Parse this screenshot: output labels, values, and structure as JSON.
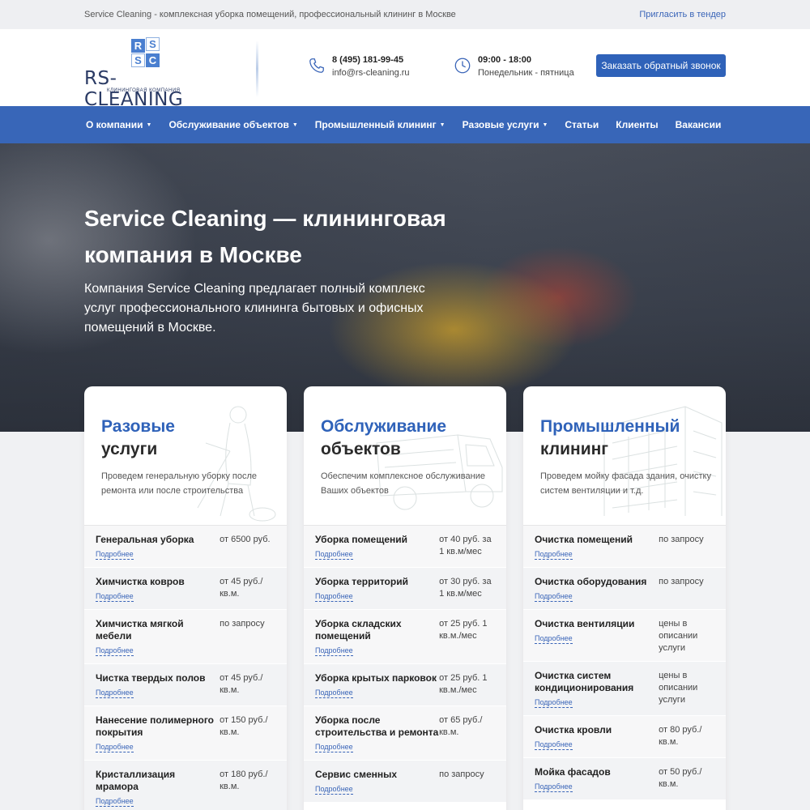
{
  "topbar": {
    "tagline": "Service Cleaning - комплексная уборка помещений, профессиональный клининг в Москве",
    "tender_link": "Пригласить в тендер"
  },
  "logo": {
    "letters": [
      "R",
      "S",
      "S",
      "C"
    ],
    "wordmark": "RS-CLEANING",
    "subtitle": "КЛИНИНГОВАЯ КОМПАНИЯ"
  },
  "contacts": {
    "phone": "8 (495) 181-99-45",
    "email": "info@rs-cleaning.ru",
    "hours": "09:00 - 18:00",
    "days": "Понедельник - пятница",
    "phone_icon": "phone-icon",
    "clock_icon": "clock-icon"
  },
  "callback_button": "Заказать обратный звонок",
  "nav": [
    {
      "label": "О компании",
      "dropdown": true
    },
    {
      "label": "Обслуживание объектов",
      "dropdown": true
    },
    {
      "label": "Промышленный клининг",
      "dropdown": true
    },
    {
      "label": "Разовые услуги",
      "dropdown": true
    },
    {
      "label": "Статьи",
      "dropdown": false
    },
    {
      "label": "Клиенты",
      "dropdown": false
    },
    {
      "label": "Вакансии",
      "dropdown": false
    }
  ],
  "hero": {
    "title": "Service Cleaning — клининговая компания в Москве",
    "text": "Компания Service Cleaning предлагает полный комплекс услуг профессионального клининга бытовых и офисных помещений в Москве."
  },
  "colors": {
    "brand": "#3866b8",
    "accent": "#2f62b9"
  },
  "cards": [
    {
      "title_1": "Разовые",
      "title_2": "услуги",
      "desc": "Проведем генеральную уборку после ремонта или после строительства",
      "more": "Подробнее",
      "rows": [
        {
          "name": "Генеральная уборка",
          "price": "от 6500 руб."
        },
        {
          "name": "Химчистка ковров",
          "price": "от 45 руб./кв.м."
        },
        {
          "name": "Химчистка мягкой мебели",
          "price": "по запросу"
        },
        {
          "name": "Чистка твердых полов",
          "price": "от 45 руб./кв.м."
        },
        {
          "name": "Нанесение полимерного покрытия",
          "price": "от 150 руб./кв.м."
        },
        {
          "name": "Кристаллизация мрамора",
          "price": "от 180 руб./кв.м."
        }
      ]
    },
    {
      "title_1": "Обслуживание",
      "title_2": "объектов",
      "desc": "Обеспечим комплексное обслуживание Ваших объектов",
      "more": "Подробнее",
      "rows": [
        {
          "name": "Уборка помещений",
          "price": "от 40 руб. за 1 кв.м/мес"
        },
        {
          "name": "Уборка территорий",
          "price": "от 30 руб. за 1 кв.м/мес"
        },
        {
          "name": "Уборка складских помещений",
          "price": "от 25 руб. 1 кв.м./мес"
        },
        {
          "name": "Уборка крытых парковок",
          "price": "от 25 руб. 1 кв.м./мес"
        },
        {
          "name": "Уборка после строительства и ремонта",
          "price": "от 65 руб./кв.м."
        },
        {
          "name": "Сервис сменных",
          "price": "по запросу"
        }
      ]
    },
    {
      "title_1": "Промышленный",
      "title_2": "клининг",
      "desc": "Проведем мойку фасада здания, очистку систем вентиляции и т.д.",
      "more": "Подробнее",
      "rows": [
        {
          "name": "Очистка помещений",
          "price": "по запросу"
        },
        {
          "name": "Очистка оборудования",
          "price": "по запросу"
        },
        {
          "name": "Очистка вентиляции",
          "price": "цены в описании услуги"
        },
        {
          "name": "Очистка систем кондиционирования",
          "price": "цены в описании услуги"
        },
        {
          "name": "Очистка кровли",
          "price": "от 80 руб./кв.м."
        },
        {
          "name": "Мойка фасадов",
          "price": "от 50 руб./кв.м."
        }
      ]
    }
  ]
}
